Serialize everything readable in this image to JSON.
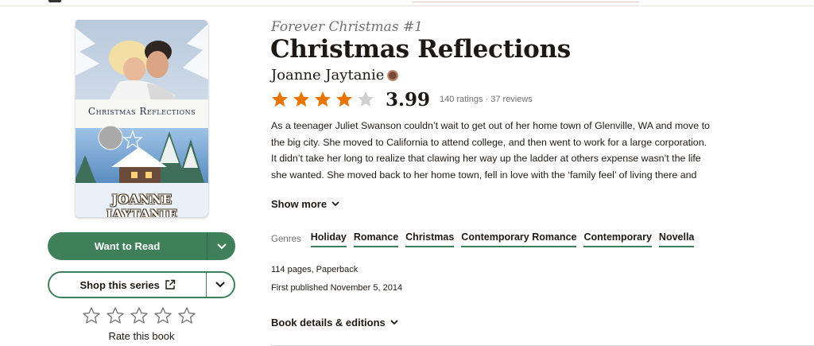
{
  "book": {
    "series": "Forever Christmas #1",
    "title": "Christmas Reflections",
    "author": "Joanne Jaytanie",
    "rating": {
      "average": "3.99",
      "stars_filled": 4,
      "stars_total": 5,
      "counts": "140 ratings · 37 reviews"
    },
    "description": "As a teenager Juliet Swanson couldn’t wait to get out of her home town of Glenville, WA and move to the big city. She moved to California to attend college, and then went to work for a large corporation. It didn’t take her long to realize that clawing her way up the ladder at others expense wasn’t the life she wanted. She moved back to her home town, fell in love with the ‘family feel’ of living there and has a close knit group of girlfriends she shares everything with. Now if she could",
    "show_more": "Show more",
    "genres_label": "Genres",
    "genres": [
      "Holiday",
      "Romance",
      "Christmas",
      "Contemporary Romance",
      "Contemporary",
      "Novella"
    ],
    "pages": "114 pages, Paperback",
    "published": "First published November 5, 2014",
    "details_link": "Book details & editions"
  },
  "cover": {
    "title": "Christmas Reflections",
    "author": "JOANNE JAYTANIE"
  },
  "actions": {
    "want_to_read": "Want to Read",
    "shop_series": "Shop this series",
    "rate_label": "Rate this book"
  },
  "icons": {
    "star_filled": "star-icon",
    "star_empty": "star-outline-icon",
    "chevron": "chevron-down-icon",
    "external": "external-link-icon"
  },
  "colors": {
    "star": "#e87400",
    "star_empty": "#d0d0d0",
    "accent_green": "#3f7f5a"
  }
}
